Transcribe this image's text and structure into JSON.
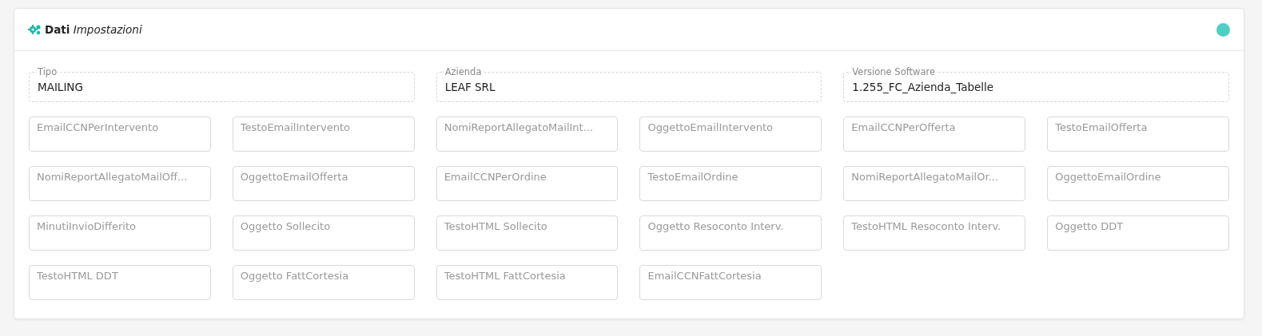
{
  "header": {
    "title_bold": "Dati",
    "title_italic": "Impostazioni"
  },
  "info_fields": [
    {
      "label": "Tipo",
      "value": "MAILING"
    },
    {
      "label": "Azienda",
      "value": "LEAF SRL"
    },
    {
      "label": "Versione Software",
      "value": "1.255_FC_Azienda_Tabelle"
    }
  ],
  "text_fields": [
    {
      "placeholder": "EmailCCNPerIntervento"
    },
    {
      "placeholder": "TestoEmailIntervento"
    },
    {
      "placeholder": "NomiReportAllegatoMailInt..."
    },
    {
      "placeholder": "OggettoEmailIntervento"
    },
    {
      "placeholder": "EmailCCNPerOfferta"
    },
    {
      "placeholder": "TestoEmailOfferta"
    },
    {
      "placeholder": "NomiReportAllegatoMailOff..."
    },
    {
      "placeholder": "OggettoEmailOfferta"
    },
    {
      "placeholder": "EmailCCNPerOrdine"
    },
    {
      "placeholder": "TestoEmailOrdine"
    },
    {
      "placeholder": "NomiReportAllegatoMailOr..."
    },
    {
      "placeholder": "OggettoEmailOrdine"
    },
    {
      "placeholder": "MinutiInvioDifferito"
    },
    {
      "placeholder": "Oggetto Sollecito"
    },
    {
      "placeholder": "TestoHTML Sollecito"
    },
    {
      "placeholder": "Oggetto Resoconto Interv."
    },
    {
      "placeholder": "TestoHTML Resoconto Interv."
    },
    {
      "placeholder": "Oggetto DDT"
    },
    {
      "placeholder": "TestoHTML DDT"
    },
    {
      "placeholder": "Oggetto FattCortesia"
    },
    {
      "placeholder": "TestoHTML FattCortesia"
    },
    {
      "placeholder": "EmailCCNFattCortesia"
    }
  ]
}
